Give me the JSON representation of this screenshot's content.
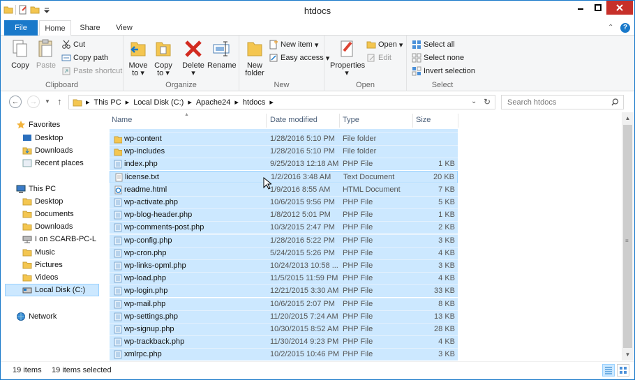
{
  "window": {
    "title": "htdocs"
  },
  "tabs": {
    "file": "File",
    "home": "Home",
    "share": "Share",
    "view": "View"
  },
  "ribbon": {
    "clipboard": {
      "label": "Clipboard",
      "copy": "Copy",
      "paste": "Paste",
      "cut": "Cut",
      "copy_path": "Copy path",
      "paste_shortcut": "Paste shortcut"
    },
    "organize": {
      "label": "Organize",
      "move_to": "Move",
      "move_to2": "to",
      "copy_to": "Copy",
      "copy_to2": "to",
      "delete": "Delete",
      "rename": "Rename"
    },
    "new": {
      "label": "New",
      "new_folder": "New",
      "new_folder2": "folder",
      "new_item": "New item",
      "easy_access": "Easy access"
    },
    "open": {
      "label": "Open",
      "properties": "Properties",
      "open": "Open",
      "edit": "Edit"
    },
    "select": {
      "label": "Select",
      "select_all": "Select all",
      "select_none": "Select none",
      "invert_selection": "Invert selection"
    }
  },
  "address": {
    "crumbs": [
      "This PC",
      "Local Disk (C:)",
      "Apache24",
      "htdocs"
    ],
    "search_placeholder": "Search htdocs"
  },
  "nav": {
    "favorites": "Favorites",
    "fav_items": [
      "Desktop",
      "Downloads",
      "Recent places"
    ],
    "this_pc": "This PC",
    "pc_items": [
      "Desktop",
      "Documents",
      "Downloads",
      "I on SCARB-PC-L",
      "Music",
      "Pictures",
      "Videos",
      "Local Disk (C:)"
    ],
    "network": "Network"
  },
  "columns": {
    "name": "Name",
    "date": "Date modified",
    "type": "Type",
    "size": "Size"
  },
  "files": [
    {
      "name": "wp-content",
      "date": "1/28/2016 5:10 PM",
      "type": "File folder",
      "size": "",
      "icon": "folder"
    },
    {
      "name": "wp-includes",
      "date": "1/28/2016 5:10 PM",
      "type": "File folder",
      "size": "",
      "icon": "folder"
    },
    {
      "name": "index.php",
      "date": "9/25/2013 12:18 AM",
      "type": "PHP File",
      "size": "1 KB",
      "icon": "php"
    },
    {
      "name": "license.txt",
      "date": "1/2/2016 3:48 AM",
      "type": "Text Document",
      "size": "20 KB",
      "icon": "txt"
    },
    {
      "name": "readme.html",
      "date": "1/9/2016 8:55 AM",
      "type": "HTML Document",
      "size": "7 KB",
      "icon": "html"
    },
    {
      "name": "wp-activate.php",
      "date": "10/6/2015 9:56 PM",
      "type": "PHP File",
      "size": "5 KB",
      "icon": "php"
    },
    {
      "name": "wp-blog-header.php",
      "date": "1/8/2012 5:01 PM",
      "type": "PHP File",
      "size": "1 KB",
      "icon": "php"
    },
    {
      "name": "wp-comments-post.php",
      "date": "10/3/2015 2:47 PM",
      "type": "PHP File",
      "size": "2 KB",
      "icon": "php"
    },
    {
      "name": "wp-config.php",
      "date": "1/28/2016 5:22 PM",
      "type": "PHP File",
      "size": "3 KB",
      "icon": "php"
    },
    {
      "name": "wp-cron.php",
      "date": "5/24/2015 5:26 PM",
      "type": "PHP File",
      "size": "4 KB",
      "icon": "php"
    },
    {
      "name": "wp-links-opml.php",
      "date": "10/24/2013 10:58 ...",
      "type": "PHP File",
      "size": "3 KB",
      "icon": "php"
    },
    {
      "name": "wp-load.php",
      "date": "11/5/2015 11:59 PM",
      "type": "PHP File",
      "size": "4 KB",
      "icon": "php"
    },
    {
      "name": "wp-login.php",
      "date": "12/21/2015 3:30 AM",
      "type": "PHP File",
      "size": "33 KB",
      "icon": "php"
    },
    {
      "name": "wp-mail.php",
      "date": "10/6/2015 2:07 PM",
      "type": "PHP File",
      "size": "8 KB",
      "icon": "php"
    },
    {
      "name": "wp-settings.php",
      "date": "11/20/2015 7:24 AM",
      "type": "PHP File",
      "size": "13 KB",
      "icon": "php"
    },
    {
      "name": "wp-signup.php",
      "date": "10/30/2015 8:52 AM",
      "type": "PHP File",
      "size": "28 KB",
      "icon": "php"
    },
    {
      "name": "wp-trackback.php",
      "date": "11/30/2014 9:23 PM",
      "type": "PHP File",
      "size": "4 KB",
      "icon": "php"
    },
    {
      "name": "xmlrpc.php",
      "date": "10/2/2015 10:46 PM",
      "type": "PHP File",
      "size": "3 KB",
      "icon": "php"
    }
  ],
  "status": {
    "items": "19 items",
    "selected": "19 items selected"
  },
  "colors": {
    "accent": "#1979ca",
    "selection": "#cce8ff",
    "close": "#c7302a"
  }
}
